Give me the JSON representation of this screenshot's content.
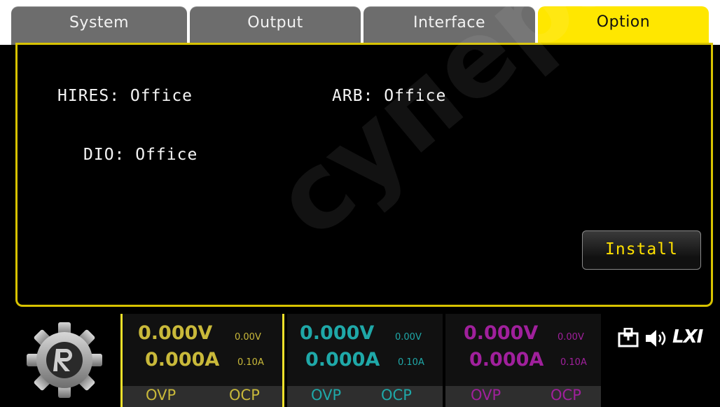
{
  "tabs": [
    {
      "label": "System",
      "active": false
    },
    {
      "label": "Output",
      "active": false
    },
    {
      "label": "Interface",
      "active": false
    },
    {
      "label": "Option",
      "active": true
    }
  ],
  "options": {
    "hires": "HIRES: Office",
    "arb": "ARB: Office",
    "dio": "DIO: Office",
    "install_label": "Install"
  },
  "channels": [
    {
      "voltage": "0.000V",
      "current": "0.000A",
      "set_v": "0.00V",
      "set_a": "0.10A",
      "ovp": "OVP",
      "ocp": "OCP",
      "color": "#c9b93a",
      "selected": true
    },
    {
      "voltage": "0.000V",
      "current": "0.000A",
      "set_v": "0.00V",
      "set_a": "0.10A",
      "ovp": "OVP",
      "ocp": "OCP",
      "color": "#1fa8a8",
      "selected": false
    },
    {
      "voltage": "0.000V",
      "current": "0.000A",
      "set_v": "0.00V",
      "set_a": "0.10A",
      "ovp": "OVP",
      "ocp": "OCP",
      "color": "#a0209c",
      "selected": false
    }
  ],
  "status": {
    "lxi_label": "LXI",
    "icons": [
      "network-icon",
      "speaker-icon"
    ]
  },
  "watermark": "суперайс",
  "colors": {
    "accent": "#ffe700",
    "tab_inactive": "#6d6d6d",
    "panel_border": "#d8c300"
  }
}
